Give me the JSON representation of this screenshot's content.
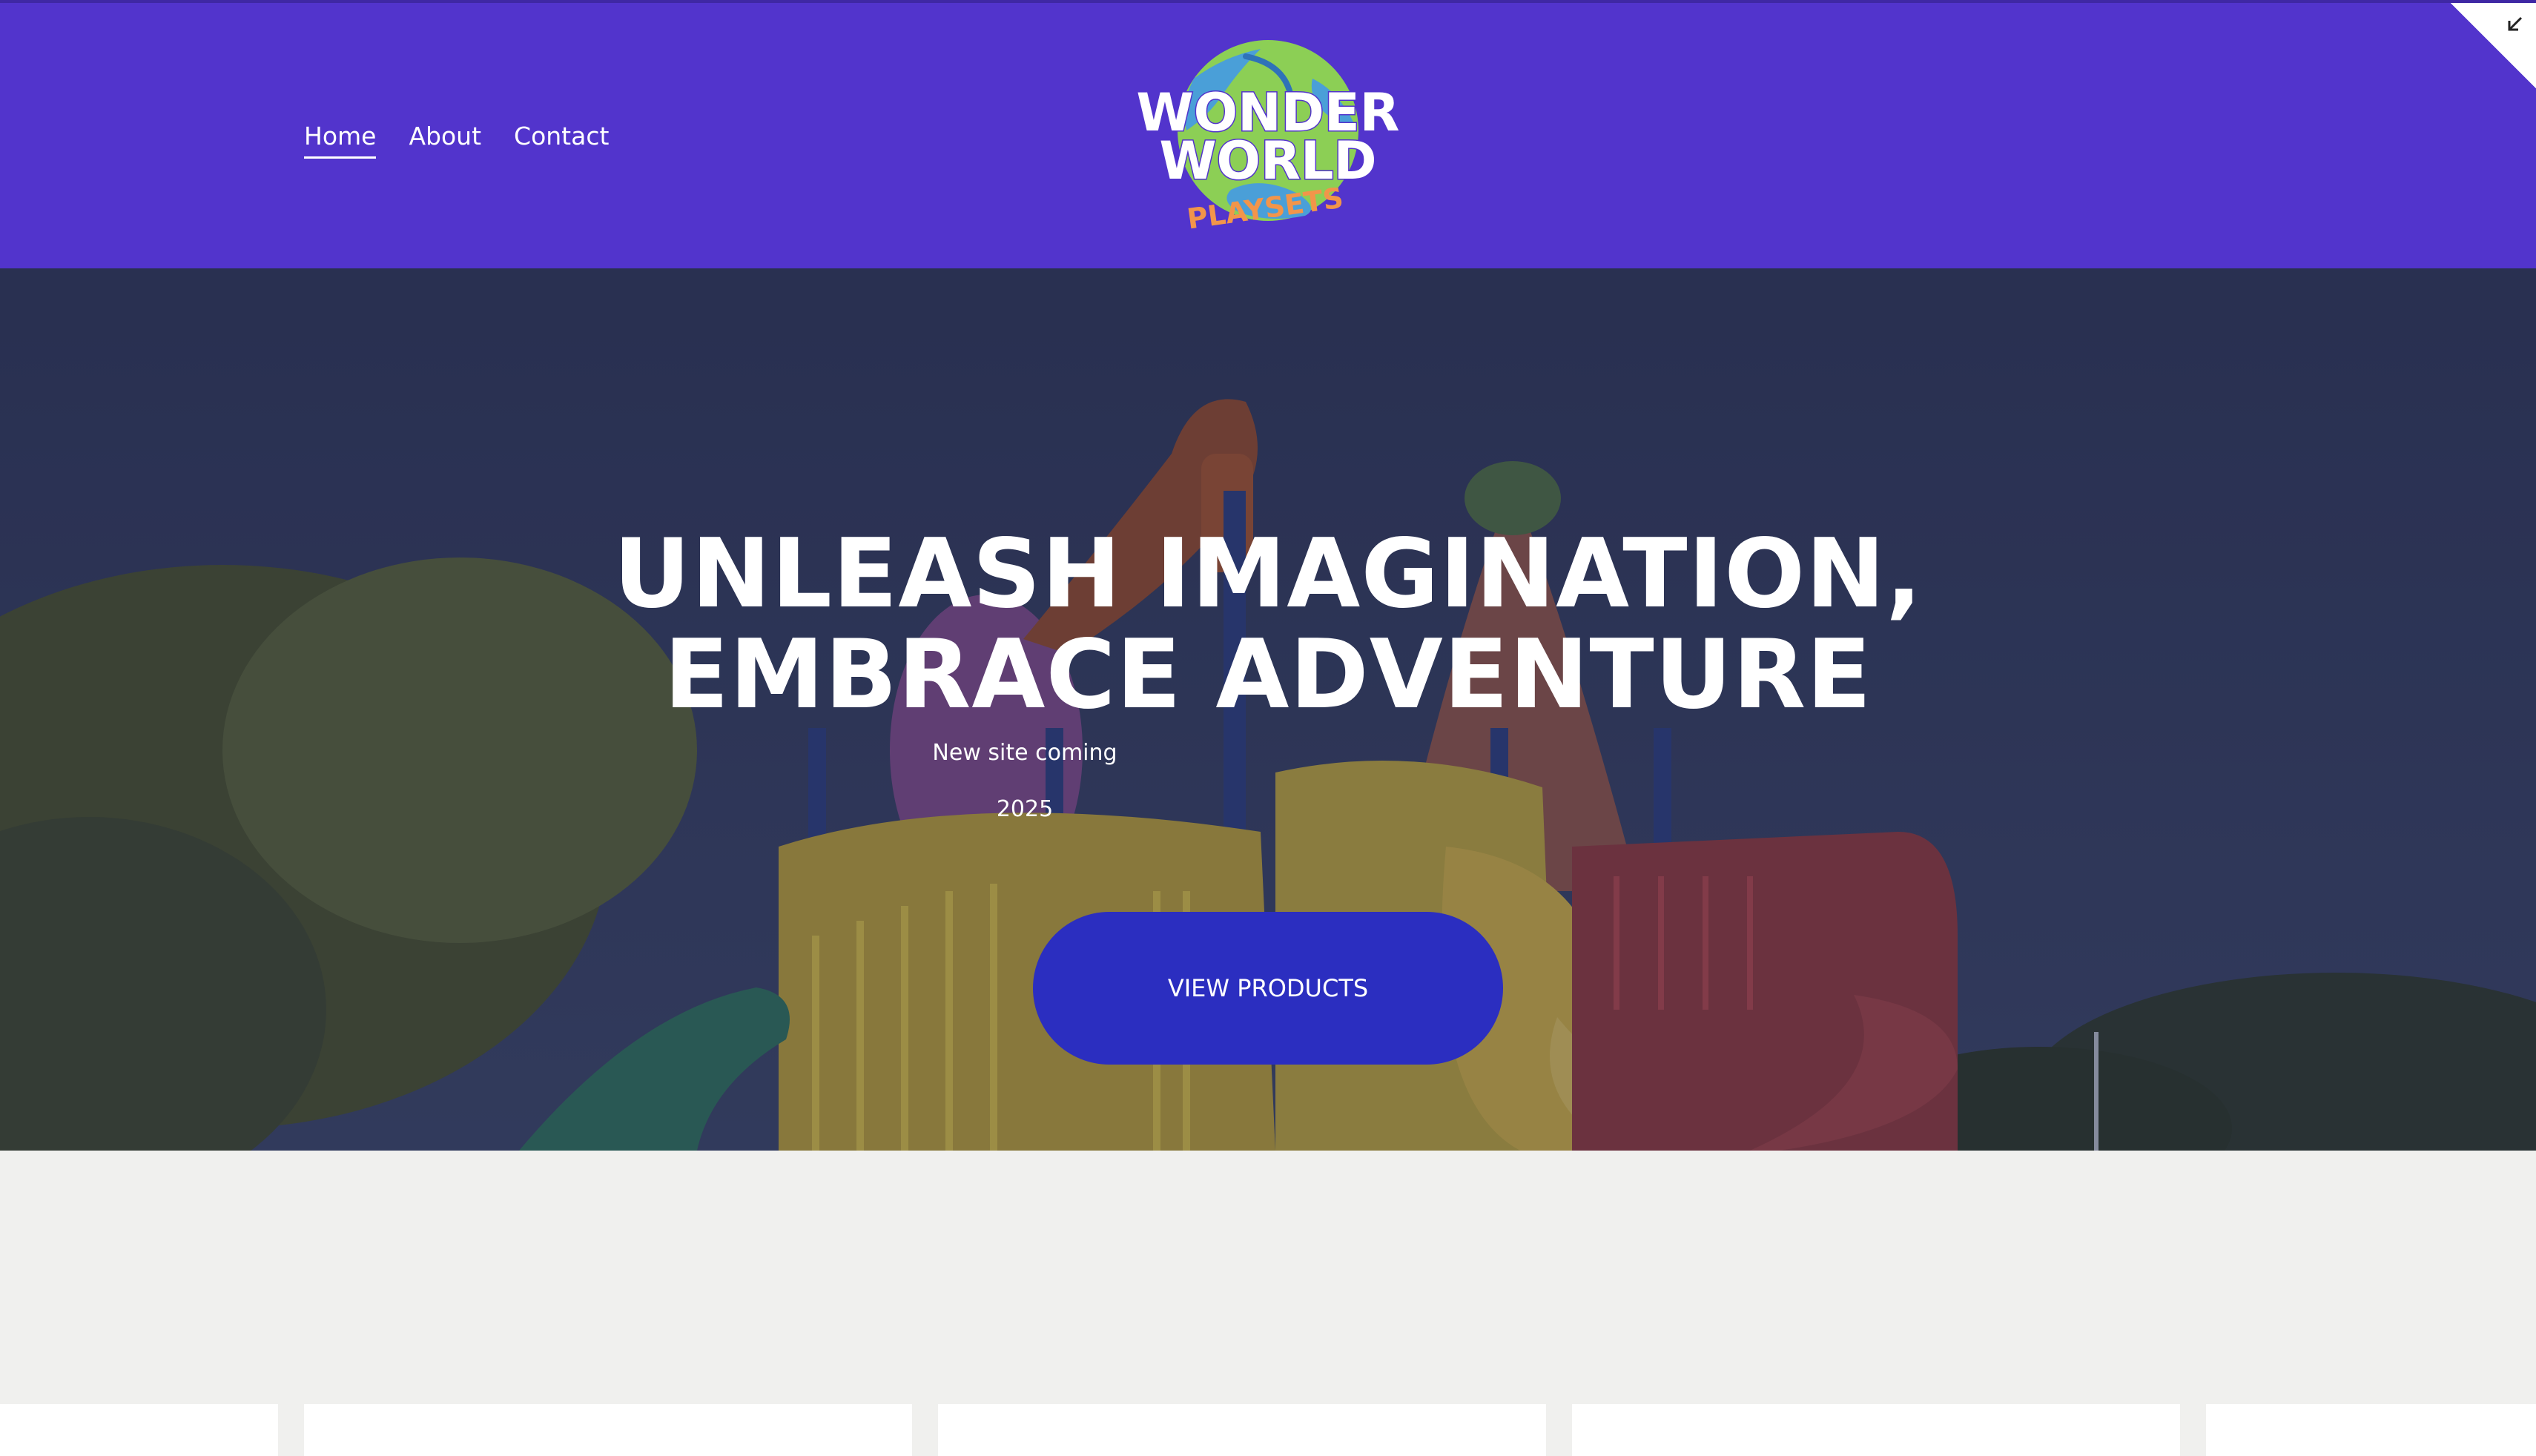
{
  "nav": {
    "items": [
      {
        "label": "Home",
        "active": true
      },
      {
        "label": "About",
        "active": false
      },
      {
        "label": "Contact",
        "active": false
      }
    ]
  },
  "logo": {
    "line1": "WONDER",
    "line2": "WORLD",
    "line3": "PLAYSETS"
  },
  "hero": {
    "title_line1": "UNLEASH IMAGINATION,",
    "title_line2": "EMBRACE ADVENTURE",
    "subtitle": "New site coming",
    "year": "2025",
    "button_label": "VIEW PRODUCTS"
  },
  "icons": {
    "corner": "collapse-arrow-icon"
  },
  "colors": {
    "header_bg": "#5234cc",
    "button_bg": "#2b2ec0",
    "lower_bg": "#f0f0ee"
  }
}
